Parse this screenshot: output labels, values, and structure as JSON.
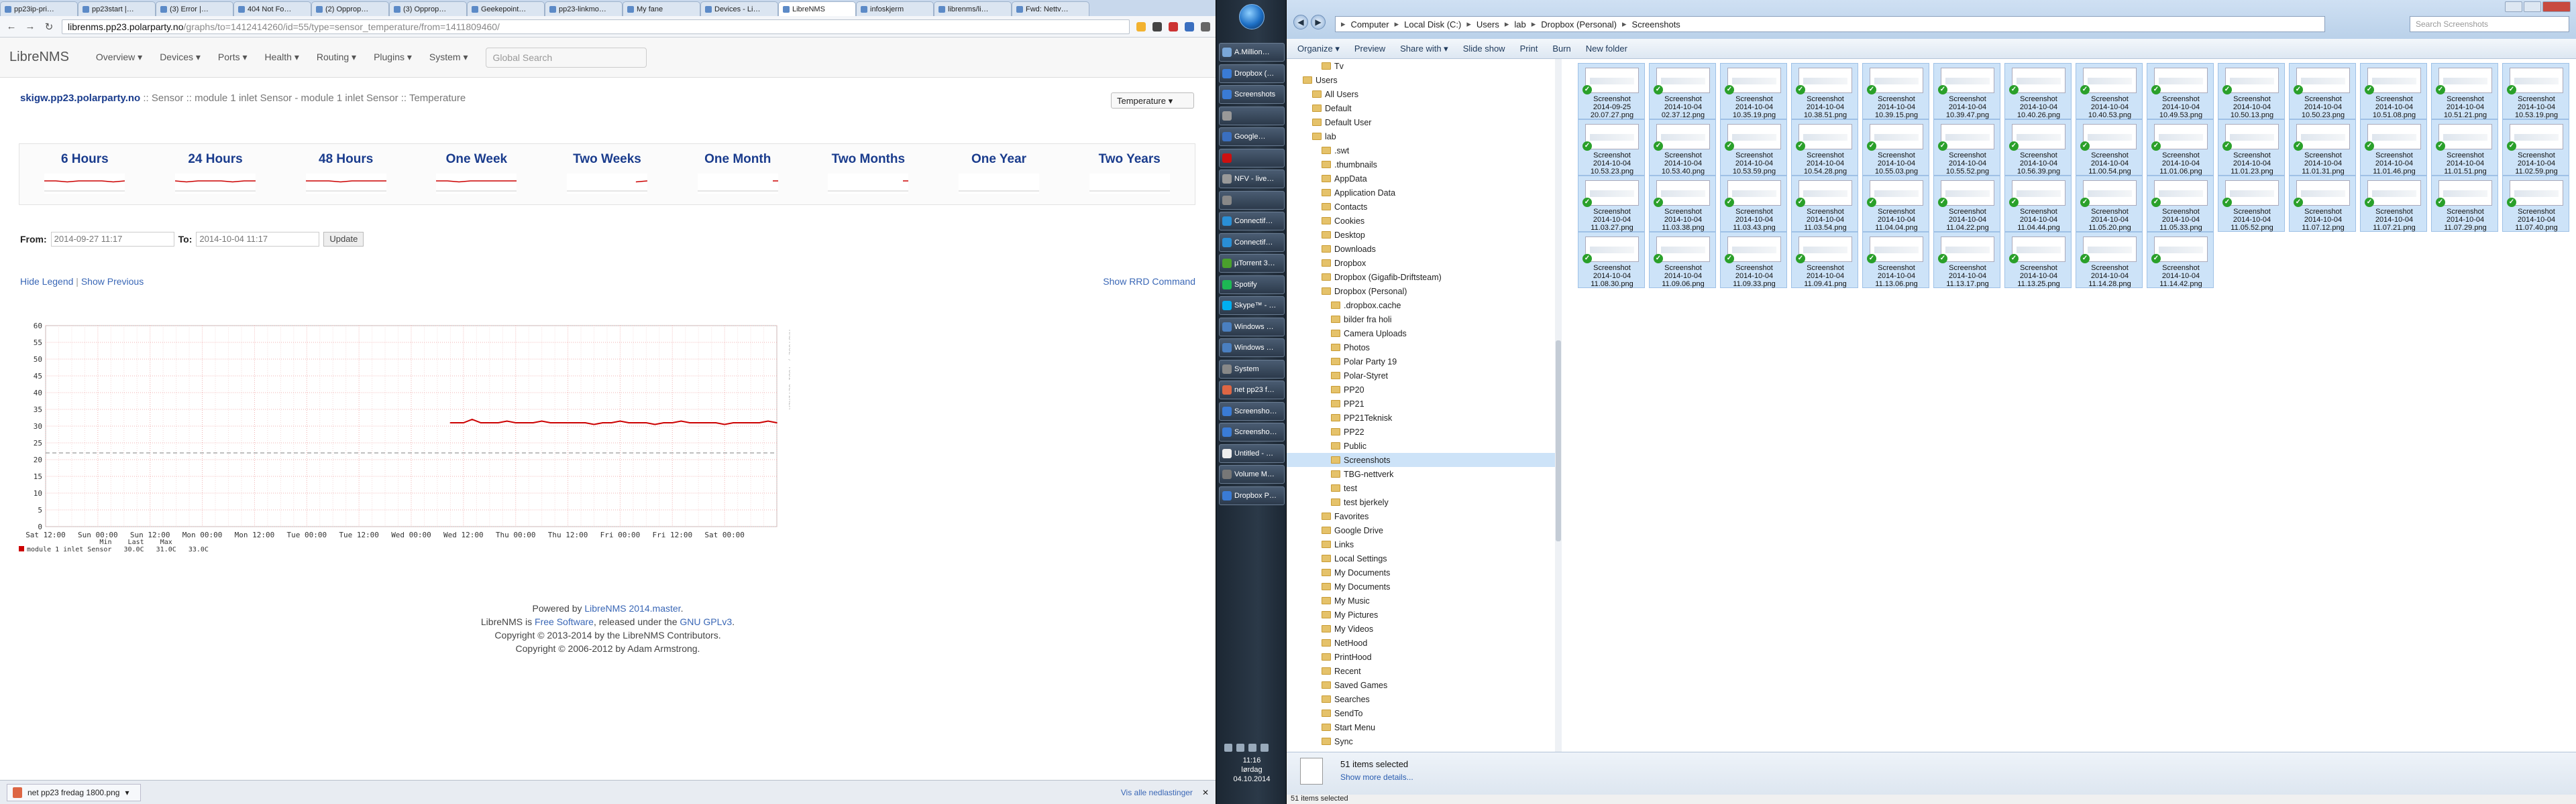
{
  "browser": {
    "tabs": [
      "pp23ip-pri…",
      "pp23start |…",
      "(3) Error |…",
      "404 Not Fo…",
      "(2) Opprop…",
      "(3) Opprop…",
      "Geekepoint…",
      "pp23-linkmo…",
      "My fane",
      "Devices - Li…",
      "LibreNMS",
      "infoskjerm",
      "librenms/li…",
      "Fwd: Nettv…"
    ],
    "active_tab": 10,
    "url_host": "librenms.pp23.polarparty.no",
    "url_path": "/graphs/to=1412414260/id=55/type=sensor_temperature/from=1411809460/",
    "nav": {
      "back": "←",
      "forward": "→",
      "reload": "↻"
    }
  },
  "librenms": {
    "brand": "LibreNMS",
    "menu": [
      "Overview ▾",
      "Devices ▾",
      "Ports ▾",
      "Health ▾",
      "Routing ▾",
      "Plugins ▾",
      "System ▾"
    ],
    "search_placeholder": "Global Search",
    "breadcrumb": {
      "host": "skigw.pp23.polarparty.no",
      "path": " :: Sensor :: module 1 inlet Sensor - module 1 inlet Sensor :: Temperature"
    },
    "graph_type": "Temperature ▾",
    "periods": [
      {
        "label": "6 Hours",
        "spark": [
          0.5,
          0.5,
          0.45,
          0.5,
          0.5,
          0.5,
          0.45,
          0.5
        ]
      },
      {
        "label": "24 Hours",
        "spark": [
          0.5,
          0.45,
          0.5,
          0.5,
          0.5,
          0.45,
          0.5,
          0.5
        ]
      },
      {
        "label": "48 Hours",
        "spark": [
          0.5,
          0.5,
          0.5,
          0.45,
          0.5,
          0.5,
          0.5,
          0.5
        ]
      },
      {
        "label": "One Week",
        "spark": [
          0.5,
          0.5,
          0.45,
          0.5,
          0.5,
          0.5,
          0.5,
          0.5
        ]
      },
      {
        "label": "Two Weeks",
        "spark": [
          null,
          null,
          null,
          null,
          null,
          null,
          0.45,
          0.5
        ]
      },
      {
        "label": "One Month",
        "spark": [
          null,
          null,
          null,
          null,
          null,
          null,
          null,
          0.5
        ]
      },
      {
        "label": "Two Months",
        "spark": [
          null,
          null,
          null,
          null,
          null,
          null,
          null,
          0.5
        ]
      },
      {
        "label": "One Year",
        "spark": []
      },
      {
        "label": "Two Years",
        "spark": []
      }
    ],
    "from_label": "From:",
    "from_value": "2014-09-27 11:17",
    "to_label": "To:",
    "to_value": "2014-10-04 11:17",
    "update_button": "Update",
    "hide_legend": "Hide Legend",
    "show_previous": "Show Previous",
    "show_rrd": "Show RRD Command",
    "legend": {
      "header": "                    Min    Last    Max",
      "row": "module 1 inlet Sensor   30.0C   31.0C   33.0C"
    },
    "footer": {
      "line1_pre": "Powered by ",
      "line1_link": "LibreNMS 2014.master",
      "line1_post": ".",
      "line2_pre": "LibreNMS is ",
      "line2_link": "Free Software",
      "line2_mid": ", released under the ",
      "line2_link2": "GNU GPLv3",
      "line2_post": ".",
      "line3": "Copyright © 2013-2014 by the LibreNMS Contributors.",
      "line4": "Copyright © 2006-2012 by Adam Armstrong."
    },
    "download": {
      "file": "net pp23 fredag 1800.png",
      "show_all": "Vis alle nedlastinger"
    }
  },
  "chart_data": {
    "type": "line",
    "title": "",
    "xlabel": "",
    "ylabel": "",
    "ylim": [
      0,
      60
    ],
    "yticks": [
      0,
      5,
      10,
      15,
      20,
      25,
      30,
      35,
      40,
      45,
      50,
      55,
      60
    ],
    "xticks": [
      "Sat 12:00",
      "Sun 00:00",
      "Sun 12:00",
      "Mon 00:00",
      "Mon 12:00",
      "Tue 00:00",
      "Tue 12:00",
      "Wed 00:00",
      "Wed 12:00",
      "Thu 00:00",
      "Thu 12:00",
      "Fri 00:00",
      "Fri 12:00",
      "Sat 00:00"
    ],
    "threshold": 22,
    "series": [
      {
        "name": "module 1 inlet Sensor",
        "color": "#cc0000",
        "x_hours_from_start": [
          93,
          96,
          98,
          100,
          102,
          104,
          106,
          108,
          110,
          112,
          114,
          116,
          118,
          120,
          122,
          124,
          126,
          128,
          130,
          132,
          134,
          136,
          138,
          140,
          142,
          144,
          146,
          148,
          150,
          152,
          154,
          156,
          158,
          160,
          162,
          164,
          166,
          168
        ],
        "values": [
          31,
          31,
          32,
          31,
          31,
          31,
          31.5,
          31,
          31,
          31,
          31.5,
          31,
          31,
          31,
          31,
          31,
          30.5,
          31,
          31,
          31.5,
          31,
          31,
          31,
          30.5,
          31,
          31,
          31.5,
          31,
          31,
          31,
          31,
          30.5,
          31,
          31,
          31,
          31,
          31.5,
          31
        ]
      }
    ],
    "rotated_label": "RRDTOOL / TOBI OETIKER"
  },
  "taskbar": {
    "buttons": [
      "A.Million…",
      "Dropbox (…",
      "Screenshots",
      "",
      "Google…",
      "",
      "NFV - live…",
      "",
      "Connectif…",
      "Connectif…",
      "µTorrent 3…",
      "Spotify",
      "Skype™ - …",
      "Windows …",
      "Windows …",
      "System",
      "net pp23 f…",
      "Screensho…",
      "Screensho…",
      "Untitled - …",
      "Volume M…",
      "Dropbox P…"
    ],
    "time": "11:16",
    "day": "lørdag",
    "date": "04.10.2014"
  },
  "explorer": {
    "address": [
      "Computer",
      "Local Disk (C:)",
      "Users",
      "lab",
      "Dropbox (Personal)",
      "Screenshots"
    ],
    "search_placeholder": "Search Screenshots",
    "toolbar": [
      "Organize ▾",
      "Preview",
      "Share with ▾",
      "Slide show",
      "Print",
      "Burn",
      "New folder"
    ],
    "tree": [
      {
        "label": "Tv",
        "indent": 3
      },
      {
        "label": "Users",
        "indent": 1
      },
      {
        "label": "All Users",
        "indent": 2
      },
      {
        "label": "Default",
        "indent": 2
      },
      {
        "label": "Default User",
        "indent": 2
      },
      {
        "label": "lab",
        "indent": 2
      },
      {
        "label": ".swt",
        "indent": 3
      },
      {
        "label": ".thumbnails",
        "indent": 3
      },
      {
        "label": "AppData",
        "indent": 3
      },
      {
        "label": "Application Data",
        "indent": 3
      },
      {
        "label": "Contacts",
        "indent": 3
      },
      {
        "label": "Cookies",
        "indent": 3
      },
      {
        "label": "Desktop",
        "indent": 3
      },
      {
        "label": "Downloads",
        "indent": 3
      },
      {
        "label": "Dropbox",
        "indent": 3
      },
      {
        "label": "Dropbox (Gigafib-Driftsteam)",
        "indent": 3
      },
      {
        "label": "Dropbox (Personal)",
        "indent": 3
      },
      {
        "label": ".dropbox.cache",
        "indent": 4
      },
      {
        "label": "bilder fra holi",
        "indent": 4
      },
      {
        "label": "Camera Uploads",
        "indent": 4
      },
      {
        "label": "Photos",
        "indent": 4
      },
      {
        "label": "Polar Party 19",
        "indent": 4
      },
      {
        "label": "Polar-Styret",
        "indent": 4
      },
      {
        "label": "PP20",
        "indent": 4
      },
      {
        "label": "PP21",
        "indent": 4
      },
      {
        "label": "PP21Teknisk",
        "indent": 4
      },
      {
        "label": "PP22",
        "indent": 4
      },
      {
        "label": "Public",
        "indent": 4
      },
      {
        "label": "Screenshots",
        "indent": 4,
        "selected": true
      },
      {
        "label": "TBG-nettverk",
        "indent": 4
      },
      {
        "label": "test",
        "indent": 4
      },
      {
        "label": "test bjerkely",
        "indent": 4
      },
      {
        "label": "Favorites",
        "indent": 3
      },
      {
        "label": "Google Drive",
        "indent": 3
      },
      {
        "label": "Links",
        "indent": 3
      },
      {
        "label": "Local Settings",
        "indent": 3
      },
      {
        "label": "My Documents",
        "indent": 3
      },
      {
        "label": "My Documents",
        "indent": 3
      },
      {
        "label": "My Music",
        "indent": 3
      },
      {
        "label": "My Pictures",
        "indent": 3
      },
      {
        "label": "My Videos",
        "indent": 3
      },
      {
        "label": "NetHood",
        "indent": 3
      },
      {
        "label": "PrintHood",
        "indent": 3
      },
      {
        "label": "Recent",
        "indent": 3
      },
      {
        "label": "Saved Games",
        "indent": 3
      },
      {
        "label": "Searches",
        "indent": 3
      },
      {
        "label": "SendTo",
        "indent": 3
      },
      {
        "label": "Start Menu",
        "indent": 3
      },
      {
        "label": "Sync",
        "indent": 3
      }
    ],
    "files": [
      {
        "name": "Screenshot",
        "date": "2014-09-25",
        "time": "20.07.27.png"
      },
      {
        "name": "Screenshot",
        "date": "2014-10-04",
        "time": "02.37.12.png"
      },
      {
        "name": "Screenshot",
        "date": "2014-10-04",
        "time": "10.35.19.png"
      },
      {
        "name": "Screenshot",
        "date": "2014-10-04",
        "time": "10.38.51.png"
      },
      {
        "name": "Screenshot",
        "date": "2014-10-04",
        "time": "10.39.15.png"
      },
      {
        "name": "Screenshot",
        "date": "2014-10-04",
        "time": "10.39.47.png"
      },
      {
        "name": "Screenshot",
        "date": "2014-10-04",
        "time": "10.40.26.png"
      },
      {
        "name": "Screenshot",
        "date": "2014-10-04",
        "time": "10.40.53.png"
      },
      {
        "name": "Screenshot",
        "date": "2014-10-04",
        "time": "10.49.53.png"
      },
      {
        "name": "Screenshot",
        "date": "2014-10-04",
        "time": "10.50.13.png"
      },
      {
        "name": "Screenshot",
        "date": "2014-10-04",
        "time": "10.50.23.png"
      },
      {
        "name": "Screenshot",
        "date": "2014-10-04",
        "time": "10.51.08.png"
      },
      {
        "name": "Screenshot",
        "date": "2014-10-04",
        "time": "10.51.21.png"
      },
      {
        "name": "Screenshot",
        "date": "2014-10-04",
        "time": "10.53.19.png"
      },
      {
        "name": "Screenshot",
        "date": "2014-10-04",
        "time": "10.53.23.png"
      },
      {
        "name": "Screenshot",
        "date": "2014-10-04",
        "time": "10.53.40.png"
      },
      {
        "name": "Screenshot",
        "date": "2014-10-04",
        "time": "10.53.59.png"
      },
      {
        "name": "Screenshot",
        "date": "2014-10-04",
        "time": "10.54.28.png"
      },
      {
        "name": "Screenshot",
        "date": "2014-10-04",
        "time": "10.55.03.png"
      },
      {
        "name": "Screenshot",
        "date": "2014-10-04",
        "time": "10.55.52.png"
      },
      {
        "name": "Screenshot",
        "date": "2014-10-04",
        "time": "10.56.39.png"
      },
      {
        "name": "Screenshot",
        "date": "2014-10-04",
        "time": "11.00.54.png"
      },
      {
        "name": "Screenshot",
        "date": "2014-10-04",
        "time": "11.01.06.png"
      },
      {
        "name": "Screenshot",
        "date": "2014-10-04",
        "time": "11.01.23.png"
      },
      {
        "name": "Screenshot",
        "date": "2014-10-04",
        "time": "11.01.31.png"
      },
      {
        "name": "Screenshot",
        "date": "2014-10-04",
        "time": "11.01.46.png"
      },
      {
        "name": "Screenshot",
        "date": "2014-10-04",
        "time": "11.01.51.png"
      },
      {
        "name": "Screenshot",
        "date": "2014-10-04",
        "time": "11.02.59.png"
      },
      {
        "name": "Screenshot",
        "date": "2014-10-04",
        "time": "11.03.27.png"
      },
      {
        "name": "Screenshot",
        "date": "2014-10-04",
        "time": "11.03.38.png"
      },
      {
        "name": "Screenshot",
        "date": "2014-10-04",
        "time": "11.03.43.png"
      },
      {
        "name": "Screenshot",
        "date": "2014-10-04",
        "time": "11.03.54.png"
      },
      {
        "name": "Screenshot",
        "date": "2014-10-04",
        "time": "11.04.04.png"
      },
      {
        "name": "Screenshot",
        "date": "2014-10-04",
        "time": "11.04.22.png"
      },
      {
        "name": "Screenshot",
        "date": "2014-10-04",
        "time": "11.04.44.png"
      },
      {
        "name": "Screenshot",
        "date": "2014-10-04",
        "time": "11.05.20.png"
      },
      {
        "name": "Screenshot",
        "date": "2014-10-04",
        "time": "11.05.33.png"
      },
      {
        "name": "Screenshot",
        "date": "2014-10-04",
        "time": "11.05.52.png"
      },
      {
        "name": "Screenshot",
        "date": "2014-10-04",
        "time": "11.07.12.png"
      },
      {
        "name": "Screenshot",
        "date": "2014-10-04",
        "time": "11.07.21.png"
      },
      {
        "name": "Screenshot",
        "date": "2014-10-04",
        "time": "11.07.29.png"
      },
      {
        "name": "Screenshot",
        "date": "2014-10-04",
        "time": "11.07.40.png"
      },
      {
        "name": "Screenshot",
        "date": "2014-10-04",
        "time": "11.08.30.png"
      },
      {
        "name": "Screenshot",
        "date": "2014-10-04",
        "time": "11.09.06.png"
      },
      {
        "name": "Screenshot",
        "date": "2014-10-04",
        "time": "11.09.33.png"
      },
      {
        "name": "Screenshot",
        "date": "2014-10-04",
        "time": "11.09.41.png"
      },
      {
        "name": "Screenshot",
        "date": "2014-10-04",
        "time": "11.13.06.png"
      },
      {
        "name": "Screenshot",
        "date": "2014-10-04",
        "time": "11.13.17.png"
      },
      {
        "name": "Screenshot",
        "date": "2014-10-04",
        "time": "11.13.25.png"
      },
      {
        "name": "Screenshot",
        "date": "2014-10-04",
        "time": "11.14.28.png"
      },
      {
        "name": "Screenshot",
        "date": "2014-10-04",
        "time": "11.14.42.png"
      }
    ],
    "details": "51 items selected",
    "show_more": "Show more details...",
    "status": "51 items selected"
  },
  "colors": {
    "brand_link": "#1a3c8d",
    "link": "#3a67b6",
    "series": "#cc0000",
    "selection": "#cde3f8"
  }
}
